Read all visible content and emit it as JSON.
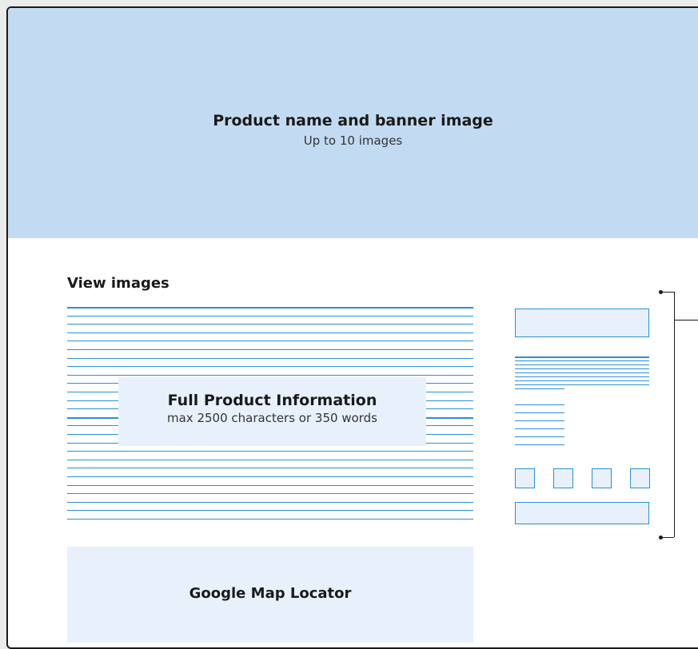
{
  "banner": {
    "title": "Product name and banner image",
    "subtitle": "Up to 10 images"
  },
  "view_images": {
    "label": "View images"
  },
  "product_info": {
    "title": "Full Product Information",
    "subtitle": "max 2500 characters or 350 words"
  },
  "map": {
    "label": "Google Map Locator"
  },
  "colors": {
    "banner_background": "#c3dbf2",
    "panel_fill": "#e8f1fb",
    "line_blue": "#2a8fd4",
    "frame_border": "#1a1a1a"
  }
}
